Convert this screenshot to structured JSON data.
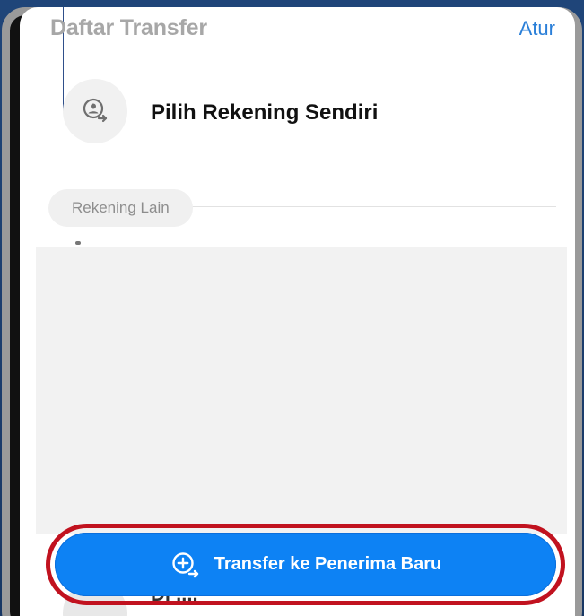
{
  "header": {
    "title": "Daftar Transfer",
    "action_label": "Atur"
  },
  "self_account": {
    "label": "Pilih Rekening Sendiri",
    "icon": "person-transfer-icon"
  },
  "section": {
    "label": "Rekening Lain"
  },
  "partial_row": {
    "label": "Di ...."
  },
  "cta": {
    "label": "Transfer ke Penerima Baru",
    "icon": "add-transfer-icon"
  },
  "colors": {
    "accent_blue": "#0d82f4",
    "link_blue": "#2a7fd8",
    "outline_red": "#c1121f"
  }
}
